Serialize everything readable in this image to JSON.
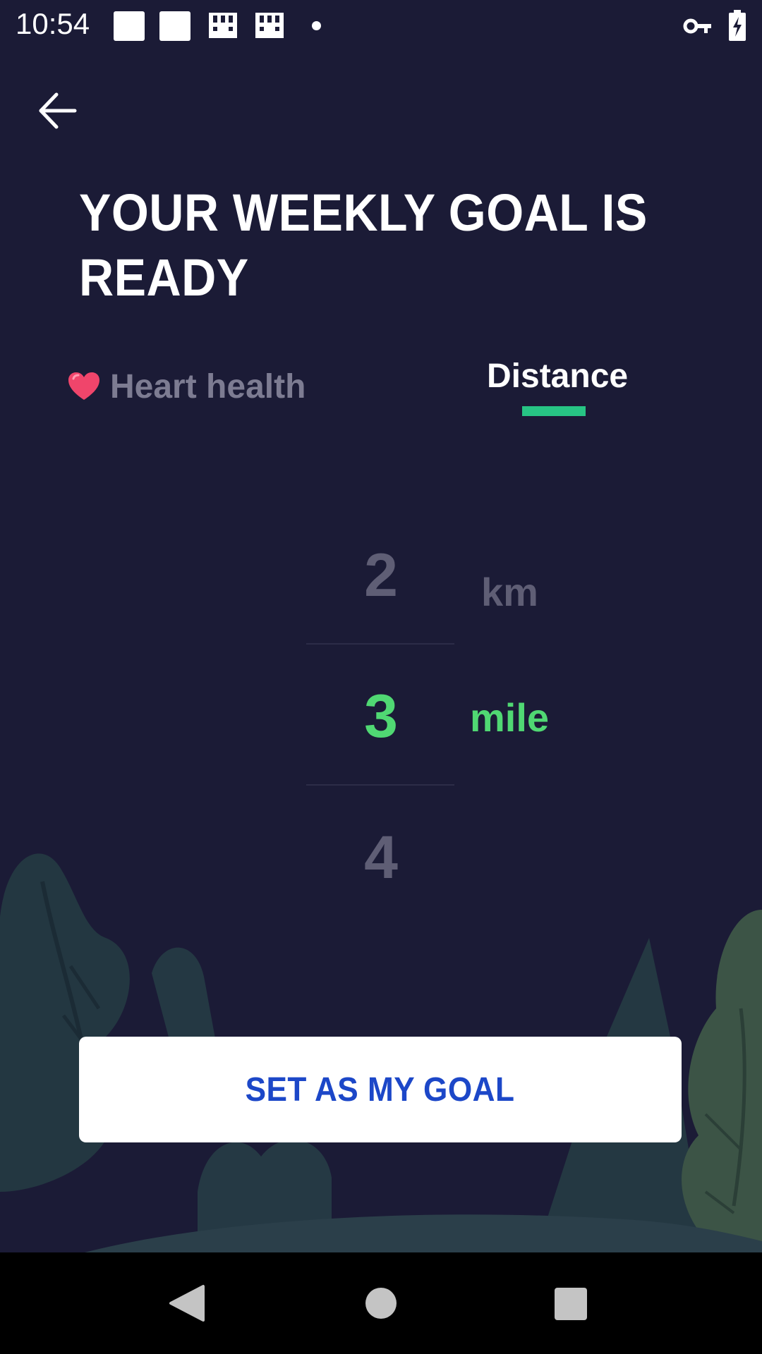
{
  "status_bar": {
    "time": "10:54",
    "icons": [
      "notification-square-icon",
      "notification-square-icon",
      "grid-app-icon",
      "grid-app-icon",
      "dot-icon",
      "vpn-key-icon",
      "battery-charging-icon"
    ]
  },
  "header": {
    "back_icon": "arrow-left-icon",
    "title": "YOUR WEEKLY GOAL IS READY"
  },
  "tabs": [
    {
      "label": "Heart health",
      "icon": "heart-icon",
      "selected": false
    },
    {
      "label": "Distance",
      "selected": true
    }
  ],
  "picker": {
    "values": [
      "2",
      "3",
      "4"
    ],
    "selected_value": "3",
    "units": [
      "km",
      "mile"
    ],
    "selected_unit": "mile"
  },
  "cta": {
    "label": "SET AS MY GOAL"
  },
  "nav_bar": {
    "icons": [
      "nav-back-icon",
      "nav-home-icon",
      "nav-recents-icon"
    ]
  },
  "colors": {
    "background": "#1b1b36",
    "accent_green": "#50d873",
    "tab_indicator": "#27c484",
    "button_text": "#1c47c8",
    "dim_text": "#5f5e75"
  }
}
